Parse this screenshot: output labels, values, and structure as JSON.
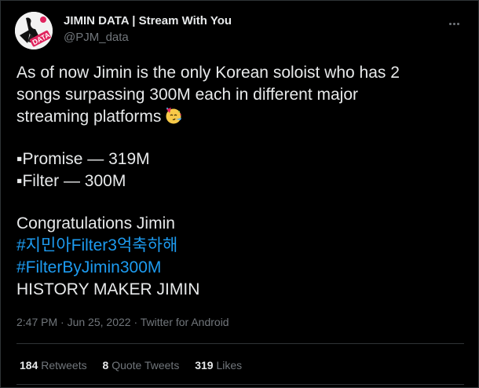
{
  "author": {
    "display_name": "JIMIN DATA | Stream With You",
    "handle": "@PJM_data",
    "avatar_text": "DATA"
  },
  "tweet": {
    "lines": [
      "As of now Jimin is the only Korean soloist who has 2",
      "songs surpassing 300M each in different major",
      "streaming platforms"
    ],
    "emoji": "partying-face-icon",
    "list": [
      "▪Promise — 319M",
      "▪Filter — 300M"
    ],
    "congrats": "Congratulations Jimin",
    "hashtag1": "#지민아Filter3억축하해",
    "hashtag2": "#FilterByJimin300M",
    "closing": "HISTORY MAKER JIMIN"
  },
  "meta": {
    "time": "2:47 PM",
    "sep1": " · ",
    "date": "Jun 25, 2022",
    "sep2": " · ",
    "source": "Twitter for Android"
  },
  "stats": {
    "retweets_count": "184",
    "retweets_label": "Retweets",
    "quotes_count": "8",
    "quotes_label": "Quote Tweets",
    "likes_count": "319",
    "likes_label": "Likes"
  },
  "colors": {
    "background": "#000000",
    "text": "#e7e9ea",
    "secondary": "#71767b",
    "link": "#1d9bf0",
    "border": "#2f3336"
  }
}
